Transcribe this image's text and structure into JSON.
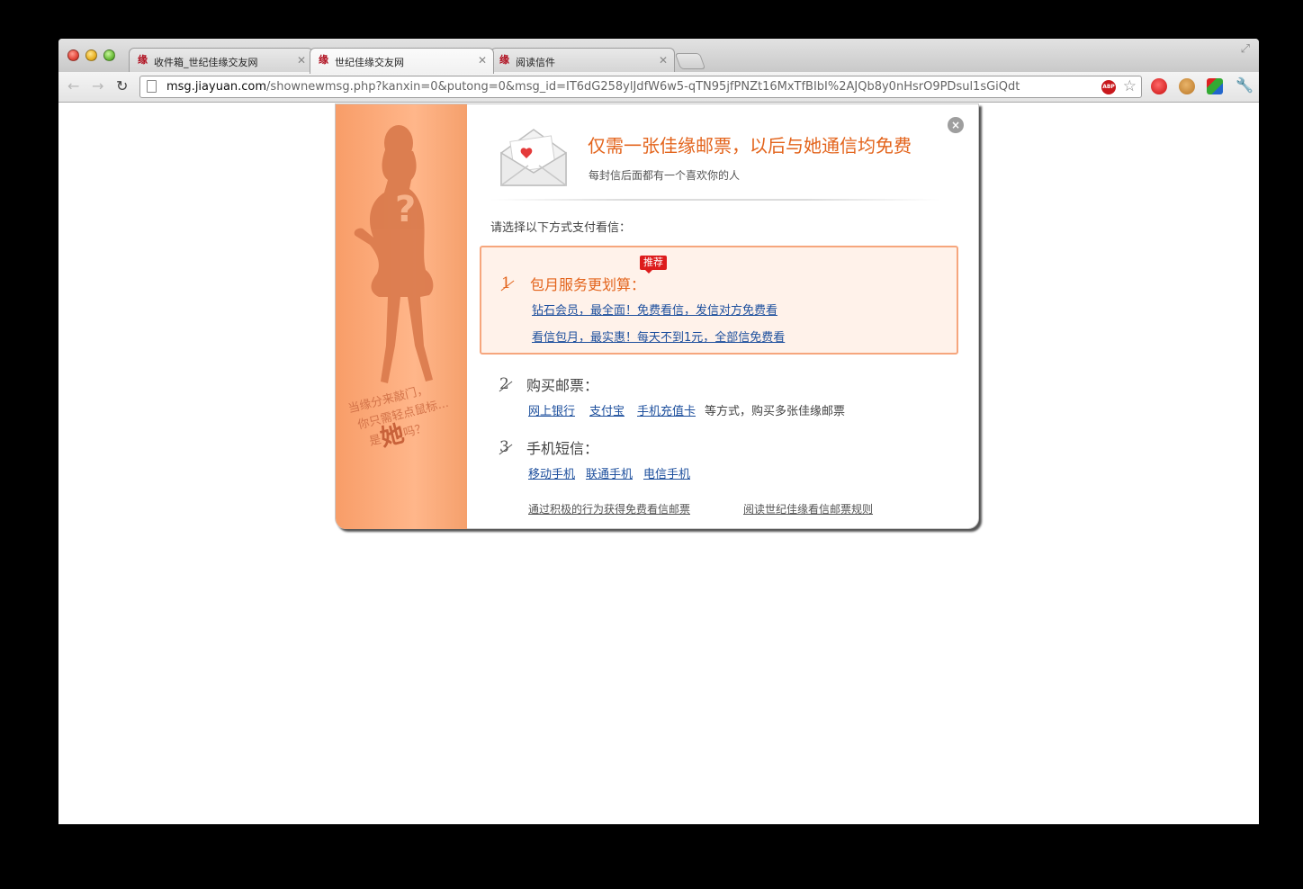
{
  "browser": {
    "tabs": [
      {
        "label": "收件箱_世纪佳缘交友网",
        "favicon": "缘"
      },
      {
        "label": "世纪佳缘交友网",
        "favicon": "缘"
      },
      {
        "label": "阅读信件",
        "favicon": "缘"
      }
    ],
    "active_tab": 1,
    "url_host": "msg.jiayuan.com",
    "url_path": "/shownewmsg.php?kanxin=0&putong=0&msg_id=IT6dG258ylJdfW6w5-qTN95jfPNZt16MxTfBIbI%2AJQb8y0nHsrO9PDsul1sGiQdt",
    "abp_label": "ABP"
  },
  "dialog": {
    "headline": "仅需一张佳缘邮票，以后与她通信均免费",
    "subline": "每封信后面都有一个喜欢你的人",
    "prompt": "请选择以下方式支付看信：",
    "sidebar_slogan": {
      "line1": "当缘分来敲门，",
      "line2": "你只需轻点鼠标...",
      "line3_pre": "是",
      "line3_big": "她",
      "line3_post": "吗？"
    },
    "sidebar_question": "?",
    "option1": {
      "number": "1",
      "badge": "推荐",
      "title": "包月服务更划算：",
      "links": [
        "钻石会员，最全面！免费看信，发信对方免费看",
        "看信包月，最实惠！每天不到1元，全部信免费看"
      ]
    },
    "option2": {
      "number": "2",
      "title": "购买邮票：",
      "links": [
        "网上银行",
        "支付宝",
        "手机充值卡"
      ],
      "suffix": "等方式，购买多张佳缘邮票"
    },
    "option3": {
      "number": "3",
      "title": "手机短信：",
      "links": [
        "移动手机",
        "联通手机",
        "电信手机"
      ]
    },
    "footer_links": [
      "通过积极的行为获得免费看信邮票",
      "阅读世纪佳缘看信邮票规则"
    ],
    "close_symbol": "×"
  },
  "colors": {
    "accent_orange": "#e3641c",
    "link_blue": "#1d4f9d",
    "badge_red": "#dd1c1c",
    "option_bg": "#fff2ea"
  }
}
